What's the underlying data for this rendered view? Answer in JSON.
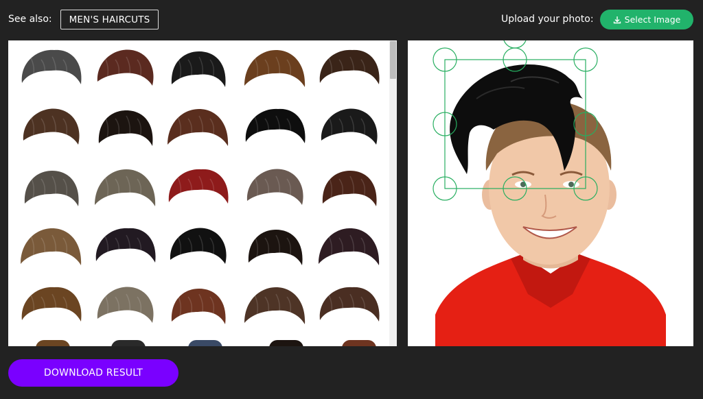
{
  "header": {
    "see_also_label": "See also:",
    "see_also_button": "MEN'S HAIRCUTS",
    "upload_label": "Upload your photo:",
    "select_image_label": "Select Image",
    "select_image_icon": "download-icon"
  },
  "gallery": {
    "item_count_visible": 25,
    "items": [
      {
        "name": "hairstyle-1",
        "color": "#4a4a4a"
      },
      {
        "name": "hairstyle-2",
        "color": "#5b2a20"
      },
      {
        "name": "hairstyle-3",
        "color": "#1a1a1a"
      },
      {
        "name": "hairstyle-4",
        "color": "#6b3f1e"
      },
      {
        "name": "hairstyle-5",
        "color": "#3a2418"
      },
      {
        "name": "hairstyle-6",
        "color": "#4d3222"
      },
      {
        "name": "hairstyle-7",
        "color": "#1c1410"
      },
      {
        "name": "hairstyle-8",
        "color": "#5a2e1e"
      },
      {
        "name": "hairstyle-9",
        "color": "#0e0e0e"
      },
      {
        "name": "hairstyle-10",
        "color": "#1a1a1a"
      },
      {
        "name": "hairstyle-11",
        "color": "#555049"
      },
      {
        "name": "hairstyle-12",
        "color": "#6d6556"
      },
      {
        "name": "hairstyle-13",
        "color": "#8e1b1b"
      },
      {
        "name": "hairstyle-14",
        "color": "#6a5a52"
      },
      {
        "name": "hairstyle-15",
        "color": "#4a2418"
      },
      {
        "name": "hairstyle-16",
        "color": "#7a5a3a"
      },
      {
        "name": "hairstyle-17",
        "color": "#221a22"
      },
      {
        "name": "hairstyle-18",
        "color": "#111111"
      },
      {
        "name": "hairstyle-19",
        "color": "#1c1410"
      },
      {
        "name": "hairstyle-20",
        "color": "#2e1c22"
      },
      {
        "name": "hairstyle-21",
        "color": "#6b4522"
      },
      {
        "name": "hairstyle-22",
        "color": "#7c7262"
      },
      {
        "name": "hairstyle-23",
        "color": "#6e3420"
      },
      {
        "name": "hairstyle-24",
        "color": "#4e3426"
      },
      {
        "name": "hairstyle-25",
        "color": "#4a2e22"
      }
    ]
  },
  "preview": {
    "overlay_color": "#0d0d0d",
    "handle_color": "#27ae60",
    "shirt_color": "#e52014",
    "skin_color": "#f1c8a8",
    "hair_color": "#8a6440"
  },
  "footer": {
    "download_label": "DOWNLOAD RESULT"
  },
  "colors": {
    "accent_green": "#21b36b",
    "accent_purple": "#7a00ff",
    "background": "#222222"
  }
}
